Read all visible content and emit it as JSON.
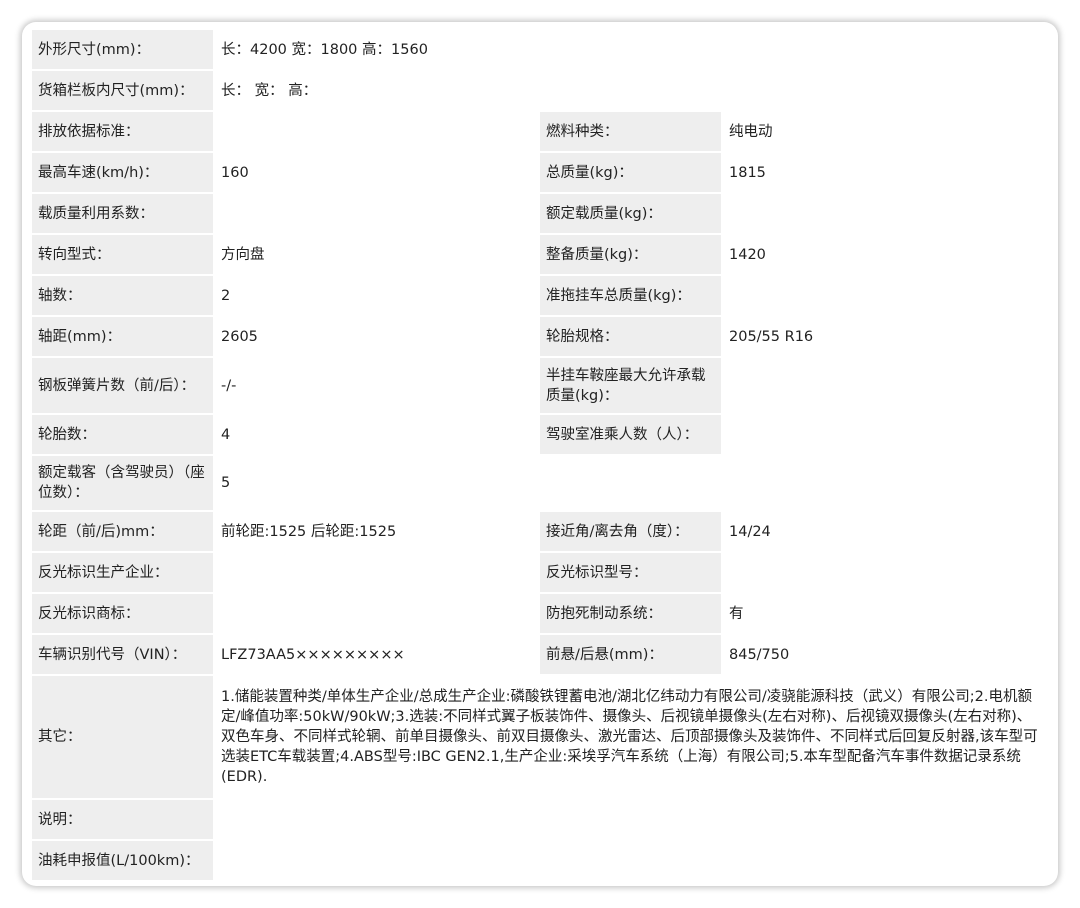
{
  "rows": [
    {
      "l1": "外形尺寸(mm)：",
      "v1": "长：4200 宽：1800 高：1560"
    },
    {
      "l1": "货箱栏板内尺寸(mm)：",
      "v1": "长： 宽： 高："
    },
    {
      "l1": "排放依据标准：",
      "v1": "",
      "l2": "燃料种类：",
      "v2": "纯电动"
    },
    {
      "l1": "最高车速(km/h)：",
      "v1": "160",
      "l2": "总质量(kg)：",
      "v2": "1815"
    },
    {
      "l1": "载质量利用系数：",
      "v1": "",
      "l2": "额定载质量(kg)：",
      "v2": ""
    },
    {
      "l1": "转向型式：",
      "v1": "方向盘",
      "l2": "整备质量(kg)：",
      "v2": "1420"
    },
    {
      "l1": "轴数：",
      "v1": "2",
      "l2": "准拖挂车总质量(kg)：",
      "v2": ""
    },
    {
      "l1": "轴距(mm)：",
      "v1": "2605",
      "l2": "轮胎规格：",
      "v2": "205/55 R16"
    },
    {
      "l1": "钢板弹簧片数（前/后）：",
      "v1": "-/-",
      "l2": "半挂车鞍座最大允许承载质量(kg)：",
      "v2": ""
    },
    {
      "l1": "轮胎数：",
      "v1": "4",
      "l2": "驾驶室准乘人数（人）：",
      "v2": ""
    },
    {
      "l1": "额定载客（含驾驶员）（座位数）：",
      "v1": "5"
    },
    {
      "l1": "轮距（前/后)mm：",
      "v1": "前轮距:1525 后轮距:1525",
      "l2": "接近角/离去角（度）：",
      "v2": "14/24"
    },
    {
      "l1": "反光标识生产企业：",
      "v1": "",
      "l2": "反光标识型号：",
      "v2": ""
    },
    {
      "l1": "反光标识商标：",
      "v1": "",
      "l2": "防抱死制动系统：",
      "v2": "有"
    },
    {
      "l1": "车辆识别代号（VIN）：",
      "v1": "LFZ73AA5×××××××××",
      "l2": "前悬/后悬(mm)：",
      "v2": "845/750"
    },
    {
      "l1": "其它：",
      "v1": "1.储能装置种类/单体生产企业/总成生产企业:磷酸铁锂蓄电池/湖北亿纬动力有限公司/凌骁能源科技（武义）有限公司;2.电机额定/峰值功率:50kW/90kW;3.选装:不同样式翼子板装饰件、摄像头、后视镜单摄像头(左右对称)、后视镜双摄像头(左右对称)、双色车身、不同样式轮辋、前单目摄像头、前双目摄像头、激光雷达、后顶部摄像头及装饰件、不同样式后回复反射器,该车型可选装ETC车载装置;4.ABS型号:IBC GEN2.1,生产企业:采埃孚汽车系统（上海）有限公司;5.本车型配备汽车事件数据记录系统(EDR)."
    },
    {
      "l1": "说明：",
      "v1": ""
    },
    {
      "l1": "油耗申报值(L/100km)：",
      "v1": ""
    }
  ]
}
